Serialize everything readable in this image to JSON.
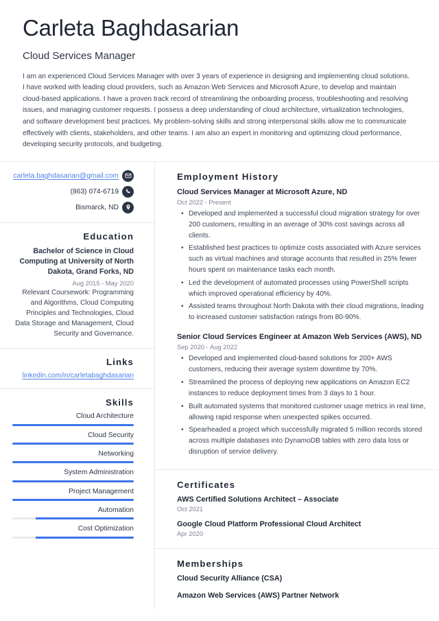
{
  "header": {
    "name": "Carleta Baghdasarian",
    "headline": "Cloud Services Manager",
    "summary": "I am an experienced Cloud Services Manager with over 3 years of experience in designing and implementing cloud solutions. I have worked with leading cloud providers, such as Amazon Web Services and Microsoft Azure, to develop and maintain cloud-based applications. I have a proven track record of streamlining the onboarding process, troubleshooting and resolving issues, and managing customer requests. I possess a deep understanding of cloud architecture, virtualization technologies, and software development best practices. My problem-solving skills and strong interpersonal skills allow me to communicate effectively with clients, stakeholders, and other teams. I am also an expert in monitoring and optimizing cloud performance, developing security protocols, and budgeting."
  },
  "contact": {
    "email": "carleta.baghdasarian@gmail.com",
    "phone": "(863) 074-6719",
    "location": "Bismarck, ND",
    "icons": {
      "email": "envelope-icon",
      "phone": "phone-icon",
      "location": "map-pin-icon"
    }
  },
  "education": {
    "heading": "Education",
    "entries": [
      {
        "title": "Bachelor of Science in Cloud Computing at University of North Dakota, Grand Forks, ND",
        "date": "Aug 2015 - May 2020",
        "description": "Relevant Coursework: Programming and Algorithms, Cloud Computing Principles and Technologies, Cloud Data Storage and Management, Cloud Security and Governance."
      }
    ]
  },
  "links": {
    "heading": "Links",
    "items": [
      {
        "label": "linkedin.com/in/carletabaghdasarian"
      }
    ]
  },
  "skills": {
    "heading": "Skills",
    "items": [
      {
        "label": "Cloud Architecture",
        "level": 100
      },
      {
        "label": "Cloud Security",
        "level": 100
      },
      {
        "label": "Networking",
        "level": 100
      },
      {
        "label": "System Administration",
        "level": 100
      },
      {
        "label": "Project Management",
        "level": 100
      },
      {
        "label": "Automation",
        "level": 81
      },
      {
        "label": "Cost Optimization",
        "level": 81
      }
    ]
  },
  "employment": {
    "heading": "Employment History",
    "jobs": [
      {
        "title": "Cloud Services Manager at Microsoft Azure, ND",
        "date": "Oct 2022 - Present",
        "bullets": [
          "Developed and implemented a successful cloud migration strategy for over 200 customers, resulting in an average of 30% cost savings across all clients.",
          "Established best practices to optimize costs associated with Azure services such as virtual machines and storage accounts that resulted in 25% fewer hours spent on maintenance tasks each month.",
          "Led the development of automated processes using PowerShell scripts which improved operational efficiency by 40%.",
          "Assisted teams throughout North Dakota with their cloud migrations, leading to increased customer satisfaction ratings from 80-90%."
        ]
      },
      {
        "title": "Senior Cloud Services Engineer at Amazon Web Services (AWS), ND",
        "date": "Sep 2020 - Aug 2022",
        "bullets": [
          "Developed and implemented cloud-based solutions for 200+ AWS customers, reducing their average system downtime by 70%.",
          "Streamlined the process of deploying new applications on Amazon EC2 instances to reduce deployment times from 3 days to 1 hour.",
          "Built automated systems that monitored customer usage metrics in real time, allowing rapid response when unexpected spikes occurred.",
          "Spearheaded a project which successfully migrated 5 million records stored across multiple databases into DynamoDB tables with zero data loss or disruption of service delivery."
        ]
      }
    ]
  },
  "certificates": {
    "heading": "Certificates",
    "items": [
      {
        "title": "AWS Certified Solutions Architect – Associate",
        "date": "Oct 2021"
      },
      {
        "title": "Google Cloud Platform Professional Cloud Architect",
        "date": "Apr 2020"
      }
    ]
  },
  "memberships": {
    "heading": "Memberships",
    "items": [
      {
        "title": "Cloud Security Alliance (CSA)"
      },
      {
        "title": "Amazon Web Services (AWS) Partner Network"
      }
    ]
  },
  "theme": {
    "accent": "#3b74ea",
    "link": "#4a7fe8",
    "heading": "#1f2634",
    "muted": "#7b8291",
    "rule": "#e6e8ec",
    "track": "#e8eaed"
  }
}
